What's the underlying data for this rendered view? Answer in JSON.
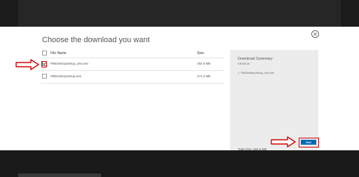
{
  "dialog": {
    "title": "Choose the download you want",
    "close_icon": "close-circle-icon"
  },
  "table": {
    "header": {
      "name": "File Name",
      "size": "Size"
    },
    "rows": [
      {
        "name": "PBIDesktopSetup_x64.exe",
        "size": "292.5 MB",
        "checked": true
      },
      {
        "name": "PBIDesktopSetup.exe",
        "size": "271.3 MB",
        "checked": false
      }
    ]
  },
  "summary": {
    "title": "Download Summary:",
    "subtitle": "KBMBGB",
    "item": "1. PBIDesktopSetup_x64.exe",
    "total": "Total Size: 292.5 MB"
  },
  "actions": {
    "next_label": "Next"
  },
  "annotations": {
    "arrow_color": "#d00000",
    "arrow_icon": "right-arrow-icon"
  },
  "colors": {
    "accent": "#0067b8",
    "highlight": "#d00000"
  }
}
